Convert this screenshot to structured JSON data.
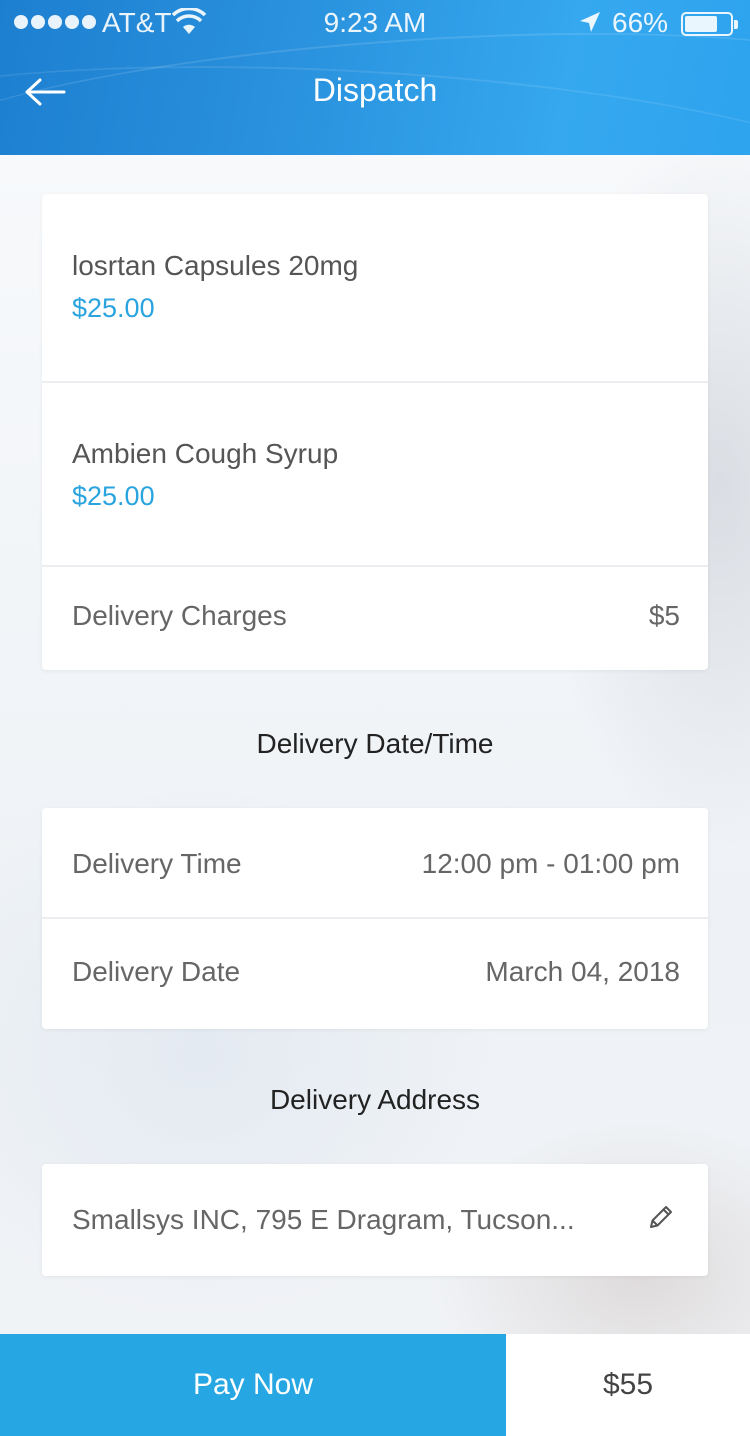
{
  "status_bar": {
    "carrier": "AT&T",
    "time": "9:23 AM",
    "battery": "66%"
  },
  "header": {
    "title": "Dispatch"
  },
  "items": [
    {
      "name": "losrtan Capsules 20mg",
      "price": "$25.00"
    },
    {
      "name": "Ambien Cough Syrup",
      "price": "$25.00"
    }
  ],
  "delivery_charges": {
    "label": "Delivery Charges",
    "value": "$5"
  },
  "datetime_section": {
    "title": "Delivery Date/Time",
    "time_label": "Delivery Time",
    "time_value": "12:00 pm - 01:00 pm",
    "date_label": "Delivery Date",
    "date_value": "March 04, 2018"
  },
  "address_section": {
    "title": "Delivery Address",
    "address": "Smallsys INC, 795 E Dragram, Tucson..."
  },
  "footer": {
    "pay_label": "Pay Now",
    "total": "$55"
  },
  "colors": {
    "accent": "#26a7e3",
    "price": "#2aa4df",
    "header_start": "#1d7fd0",
    "header_end": "#2ea3ee"
  },
  "icons": [
    "back-arrow-icon",
    "wifi-icon",
    "location-arrow-icon",
    "battery-icon",
    "pencil-icon"
  ]
}
